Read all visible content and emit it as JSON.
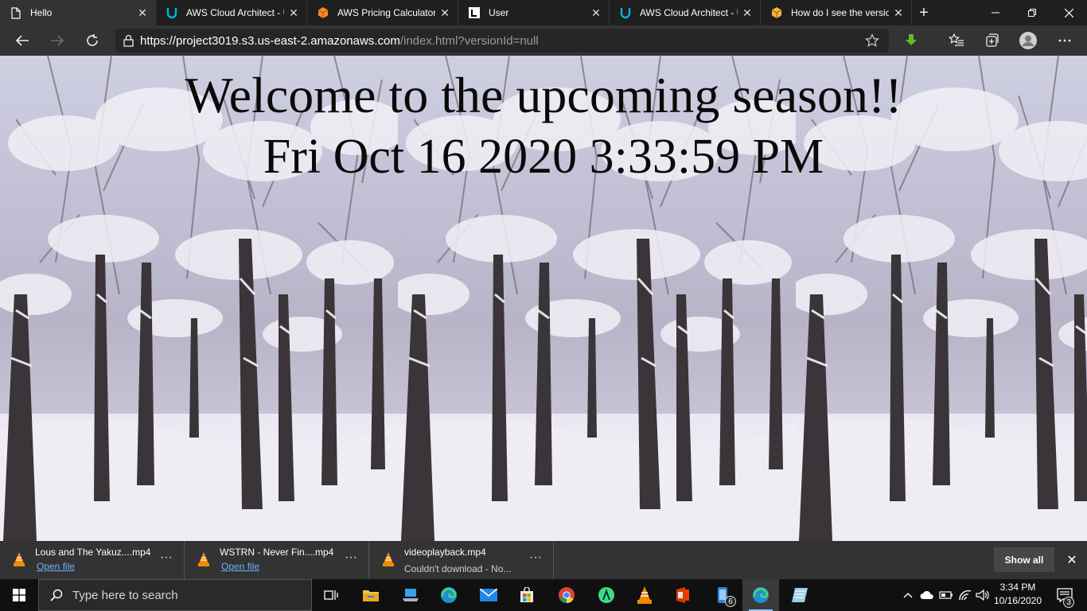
{
  "browser": {
    "tabs": [
      {
        "label": "Hello",
        "icon": "page-icon",
        "active": true
      },
      {
        "label": "AWS Cloud Architect - U",
        "icon": "udacity-icon",
        "active": false
      },
      {
        "label": "AWS Pricing Calculator",
        "icon": "aws-box-icon",
        "active": false
      },
      {
        "label": "User",
        "icon": "user-site-icon",
        "active": false
      },
      {
        "label": "AWS Cloud Architect - U",
        "icon": "udacity-icon",
        "active": false
      },
      {
        "label": "How do I see the versio",
        "icon": "s3-bucket-icon",
        "active": false
      }
    ],
    "url_main": "https://project3019.s3.us-east-2.amazonaws.com",
    "url_rest": "/index.html?versionId=null"
  },
  "page": {
    "title": "Welcome to the upcoming season!!",
    "datetime": "Fri Oct 16 2020 3:33:59 PM"
  },
  "downloads": {
    "items": [
      {
        "name": "Lous and The Yakuz....mp4",
        "sub": "Open file",
        "status": "ok"
      },
      {
        "name": "WSTRN - Never Fin....mp4",
        "sub": "Open file",
        "status": "ok"
      },
      {
        "name": "videoplayback.mp4",
        "sub": "Couldn't download - No...",
        "status": "error"
      }
    ],
    "show_all": "Show all"
  },
  "taskbar": {
    "search_placeholder": "Type here to search",
    "time": "3:34 PM",
    "date": "10/16/2020",
    "notification_count": "3",
    "store_badge": "6"
  },
  "colors": {
    "tab_bg": "#1f1f1f",
    "active_tab_bg": "#333333",
    "link": "#6db3ff",
    "vlc_orange": "#f08a00"
  }
}
